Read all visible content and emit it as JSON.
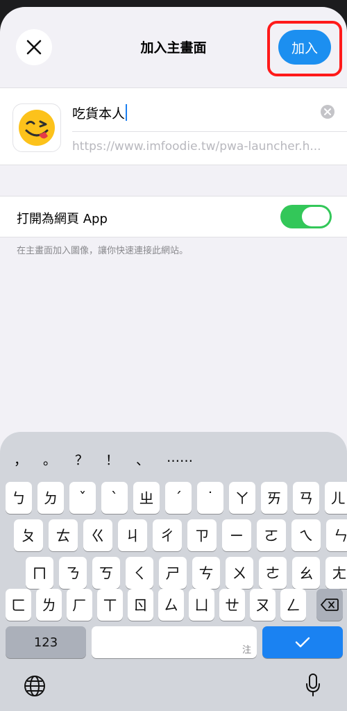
{
  "header": {
    "title": "加入主畫面",
    "add_label": "加入",
    "close_icon": "close-icon"
  },
  "web_clip": {
    "icon": "grinning-face-emoji-icon",
    "name": "吃貨本人",
    "url": "https://www.imfoodie.tw/pwa-launcher.h..."
  },
  "web_app_option": {
    "label": "打開為網頁 App",
    "enabled": true,
    "accent": "#33c759"
  },
  "footnote": "在主畫面加入圖像，讓你快速連接此網站。",
  "keyboard": {
    "candidates": [
      "，",
      "。",
      "？",
      "！",
      "、",
      "……"
    ],
    "rows": [
      [
        "ㄅ",
        "ㄉ",
        "ˇ",
        "ˋ",
        "ㄓ",
        "ˊ",
        "˙",
        "ㄚ",
        "ㄞ",
        "ㄢ",
        "ㄦ"
      ],
      [
        "ㄆ",
        "ㄊ",
        "ㄍ",
        "ㄐ",
        "ㄔ",
        "ㄗ",
        "ㄧ",
        "ㄛ",
        "ㄟ",
        "ㄣ"
      ],
      [
        "ㄇ",
        "ㄋ",
        "ㄎ",
        "ㄑ",
        "ㄕ",
        "ㄘ",
        "ㄨ",
        "ㄜ",
        "ㄠ",
        "ㄤ"
      ],
      [
        "ㄈ",
        "ㄌ",
        "ㄏ",
        "ㄒ",
        "ㄖ",
        "ㄙ",
        "ㄩ",
        "ㄝ",
        "ㄡ",
        "ㄥ"
      ]
    ],
    "numbers_label": "123",
    "space_hint": "注",
    "confirm_icon": "checkmark-icon",
    "delete_icon": "backspace-icon",
    "globe_icon": "globe-icon",
    "mic_icon": "microphone-icon",
    "accent": "#1a82f2"
  }
}
